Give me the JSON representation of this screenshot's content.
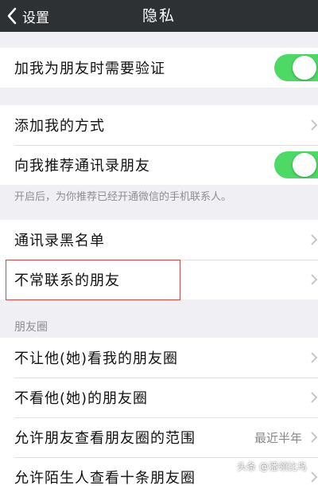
{
  "colors": {
    "navbar_bg": "#2e3133",
    "toggle_on": "#4cd964",
    "highlight_border": "#d4463e",
    "page_bg": "#efeff4"
  },
  "navbar": {
    "back_label": "设置",
    "back_icon": "chevron-left-icon",
    "title": "隐私"
  },
  "group1": {
    "verify_label": "加我为朋友时需要验证",
    "verify_toggle_on": true
  },
  "group2": {
    "add_methods_label": "添加我的方式",
    "recommend_contacts_label": "向我推荐通讯录朋友",
    "recommend_toggle_on": true
  },
  "recommend_note": "开启后，为你推荐已经开通微信的手机联系人。",
  "group3": {
    "blacklist_label": "通讯录黑名单",
    "infrequent_friends_label": "不常联系的朋友"
  },
  "moments_section": {
    "header": "朋友圈",
    "hide_my_moments_label": "不让他(她)看我的朋友圈",
    "hide_their_moments_label": "不看他(她)的朋友圈",
    "visible_range_label": "允许朋友查看朋友圈的范围",
    "visible_range_value": "最近半年",
    "strangers_label": "允许陌生人查看十条朋友圈"
  },
  "watermark": "头条 @潘领比鸟"
}
